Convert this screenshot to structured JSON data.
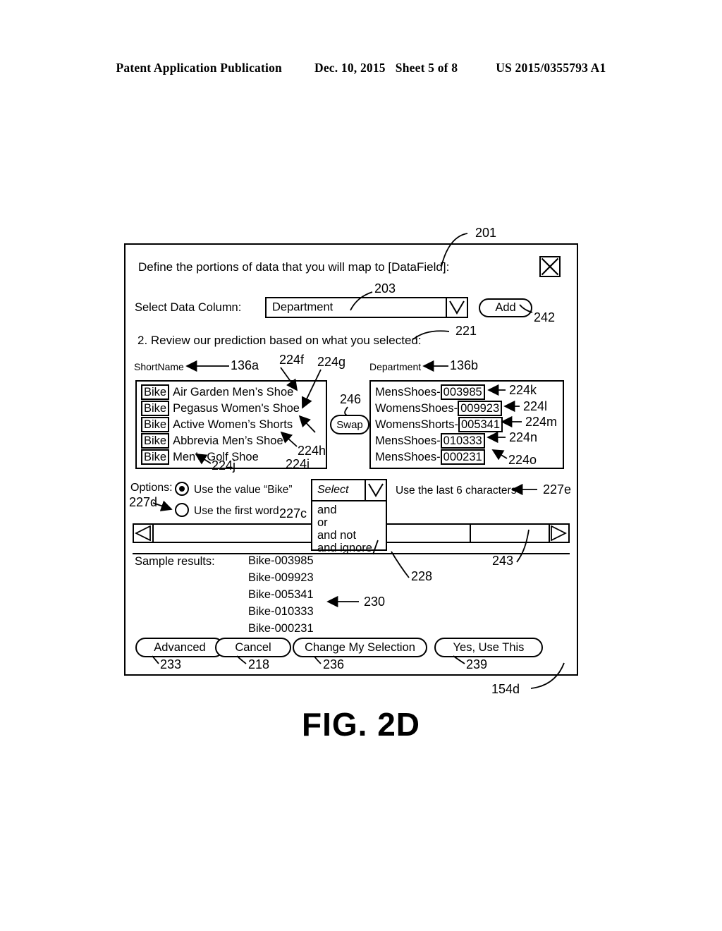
{
  "page_header": {
    "left": "Patent Application Publication",
    "date": "Dec. 10, 2015",
    "sheet": "Sheet 5 of 8",
    "doc_number": "US 2015/0355793 A1"
  },
  "figure": {
    "caption": "FIG. 2D",
    "dialog_ref": "154d",
    "title_ref": "201"
  },
  "dialog": {
    "title": "Define the portions of data that you will map to [DataField]:",
    "close_icon": "close-x-icon",
    "column_select": {
      "label": "Select Data Column:",
      "value": "Department",
      "ref": "203",
      "caret_icon": "chevron-down-icon",
      "add_button": "Add",
      "add_ref": "242"
    },
    "step2": {
      "text": "2. Review our prediction based on what you selected:",
      "ref": "221"
    },
    "left_list": {
      "header": "ShortName",
      "header_ref": "136a",
      "rows": [
        {
          "token": "Bike",
          "text": "Air Garden Men’s Shoe"
        },
        {
          "token": "Bike",
          "text": "Pegasus Women's Shoe"
        },
        {
          "token": "Bike",
          "text": "Active Women’s Shorts"
        },
        {
          "token": "Bike",
          "text": "Abbrevia Men’s Shoe"
        },
        {
          "token": "Bike",
          "text": "Men’s Golf Shoe"
        }
      ],
      "refs": [
        "224f",
        "224g",
        "224h",
        "224i",
        "224j"
      ]
    },
    "right_list": {
      "header": "Department",
      "header_ref": "136b",
      "rows": [
        {
          "prefix": "MensShoes-",
          "code": "003985",
          "ref": "224k"
        },
        {
          "prefix": "WomensShoes-",
          "code": "009923",
          "ref": "224l"
        },
        {
          "prefix": "WomensShorts-",
          "code": "005341",
          "ref": "224m"
        },
        {
          "prefix": "MensShoes-",
          "code": "010333",
          "ref": "224n"
        },
        {
          "prefix": "MensShoes-",
          "code": "000231",
          "ref": "224o"
        }
      ]
    },
    "swap_button": {
      "label": "Swap",
      "ref": "246"
    },
    "options": {
      "label": "Options:",
      "choices": [
        {
          "label": "Use the value “Bike”",
          "selected": true,
          "ref": "227c"
        },
        {
          "label": "Use the first word",
          "selected": false,
          "ref": "227d"
        }
      ],
      "last_chars_text": "Use the last 6 characters",
      "last_chars_ref": "227e"
    },
    "operator_dropdown": {
      "placeholder": "Select",
      "options": [
        "and",
        "or",
        "and not",
        "and ignore"
      ],
      "ref": "228",
      "caret_icon": "chevron-down-icon"
    },
    "scrollbar": {
      "ref": "243",
      "left_arrow_icon": "triangle-left-icon",
      "right_arrow_icon": "triangle-right-icon"
    },
    "sample_results": {
      "label": "Sample results:",
      "ref": "230",
      "values": [
        "Bike-003985",
        "Bike-009923",
        "Bike-005341",
        "Bike-010333",
        "Bike-000231"
      ]
    },
    "buttons": [
      {
        "label": "Advanced",
        "ref": "233"
      },
      {
        "label": "Cancel",
        "ref": "218"
      },
      {
        "label": "Change My Selection",
        "ref": "236"
      },
      {
        "label": "Yes, Use This",
        "ref": "239"
      }
    ]
  }
}
